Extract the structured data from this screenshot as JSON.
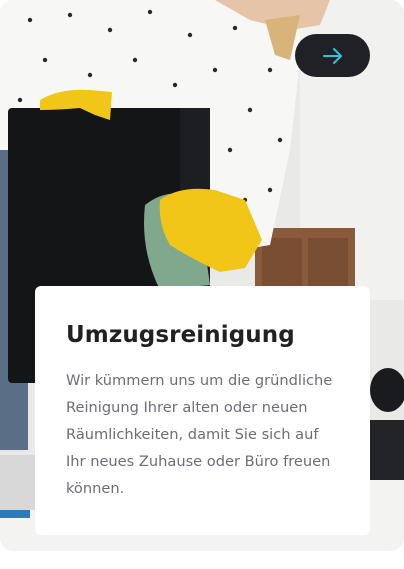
{
  "card": {
    "title": "Umzugsreinigung",
    "description": "Wir kümmern uns um die gründliche Reinigung Ihrer alten oder neuen Räumlichkeiten, damit Sie sich auf Ihr neues Zuhause oder Büro freuen können.",
    "image_subject": "cleaner-wiping-monitor-photo",
    "arrow_icon": "arrow-right-icon"
  },
  "colors": {
    "button_bg": "#1f2126",
    "arrow": "#2ec4d6",
    "title": "#1f2126",
    "text": "#6b6e74",
    "glove": "#f2c616"
  }
}
